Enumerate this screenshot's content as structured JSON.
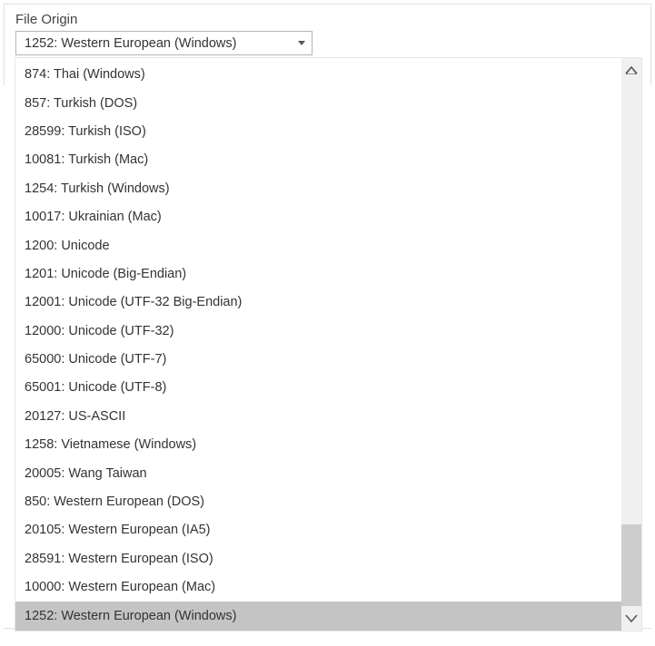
{
  "field": {
    "label": "File Origin",
    "selected": "1252: Western European (Windows)"
  },
  "options": [
    "874: Thai (Windows)",
    "857: Turkish (DOS)",
    "28599: Turkish (ISO)",
    "10081: Turkish (Mac)",
    "1254: Turkish (Windows)",
    "10017: Ukrainian (Mac)",
    "1200: Unicode",
    "1201: Unicode (Big-Endian)",
    "12001: Unicode (UTF-32 Big-Endian)",
    "12000: Unicode (UTF-32)",
    "65000: Unicode (UTF-7)",
    "65001: Unicode (UTF-8)",
    "20127: US-ASCII",
    "1258: Vietnamese (Windows)",
    "20005: Wang Taiwan",
    "850: Western European (DOS)",
    "20105: Western European (IA5)",
    "28591: Western European (ISO)",
    "10000: Western European (Mac)",
    "1252: Western European (Windows)"
  ],
  "selectedIndex": 19
}
